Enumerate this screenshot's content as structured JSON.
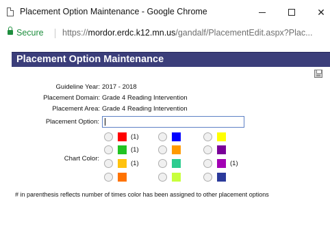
{
  "window": {
    "title": "Placement Option Maintenance - Google Chrome",
    "minimize": "—",
    "maximize": "☐",
    "close": "✕"
  },
  "address_bar": {
    "secure_label": "Secure",
    "url_scheme": "https://",
    "url_host": "mordor.erdc.k12.mn.us",
    "url_path": "/gandalf/PlacementEdit.aspx?Plac..."
  },
  "page": {
    "header_title": "Placement Option Maintenance",
    "fields": {
      "guideline_year_label": "Guideline Year:",
      "guideline_year_value": "2017 - 2018",
      "placement_domain_label": "Placement Domain:",
      "placement_domain_value": "Grade 4 Reading Intervention",
      "placement_area_label": "Placement Area:",
      "placement_area_value": "Grade 4 Reading Intervention",
      "placement_option_label": "Placement Option:",
      "placement_option_value": "",
      "chart_color_label": "Chart Color:"
    },
    "chart_colors": [
      [
        {
          "color": "#ff0000",
          "count": "(1)"
        },
        {
          "color": "#0000ff",
          "count": ""
        },
        {
          "color": "#ffff00",
          "count": ""
        }
      ],
      [
        {
          "color": "#22c322",
          "count": "(1)"
        },
        {
          "color": "#ff9a00",
          "count": ""
        },
        {
          "color": "#7a0099",
          "count": ""
        }
      ],
      [
        {
          "color": "#ffc20e",
          "count": "(1)"
        },
        {
          "color": "#2dcc8f",
          "count": ""
        },
        {
          "color": "#a200b4",
          "count": "(1)"
        }
      ],
      [
        {
          "color": "#ff7300",
          "count": ""
        },
        {
          "color": "#c8ff3c",
          "count": ""
        },
        {
          "color": "#2b3a9b",
          "count": ""
        }
      ]
    ],
    "footnote": "# in parenthesis reflects number of times color has been assigned to other placement options"
  }
}
